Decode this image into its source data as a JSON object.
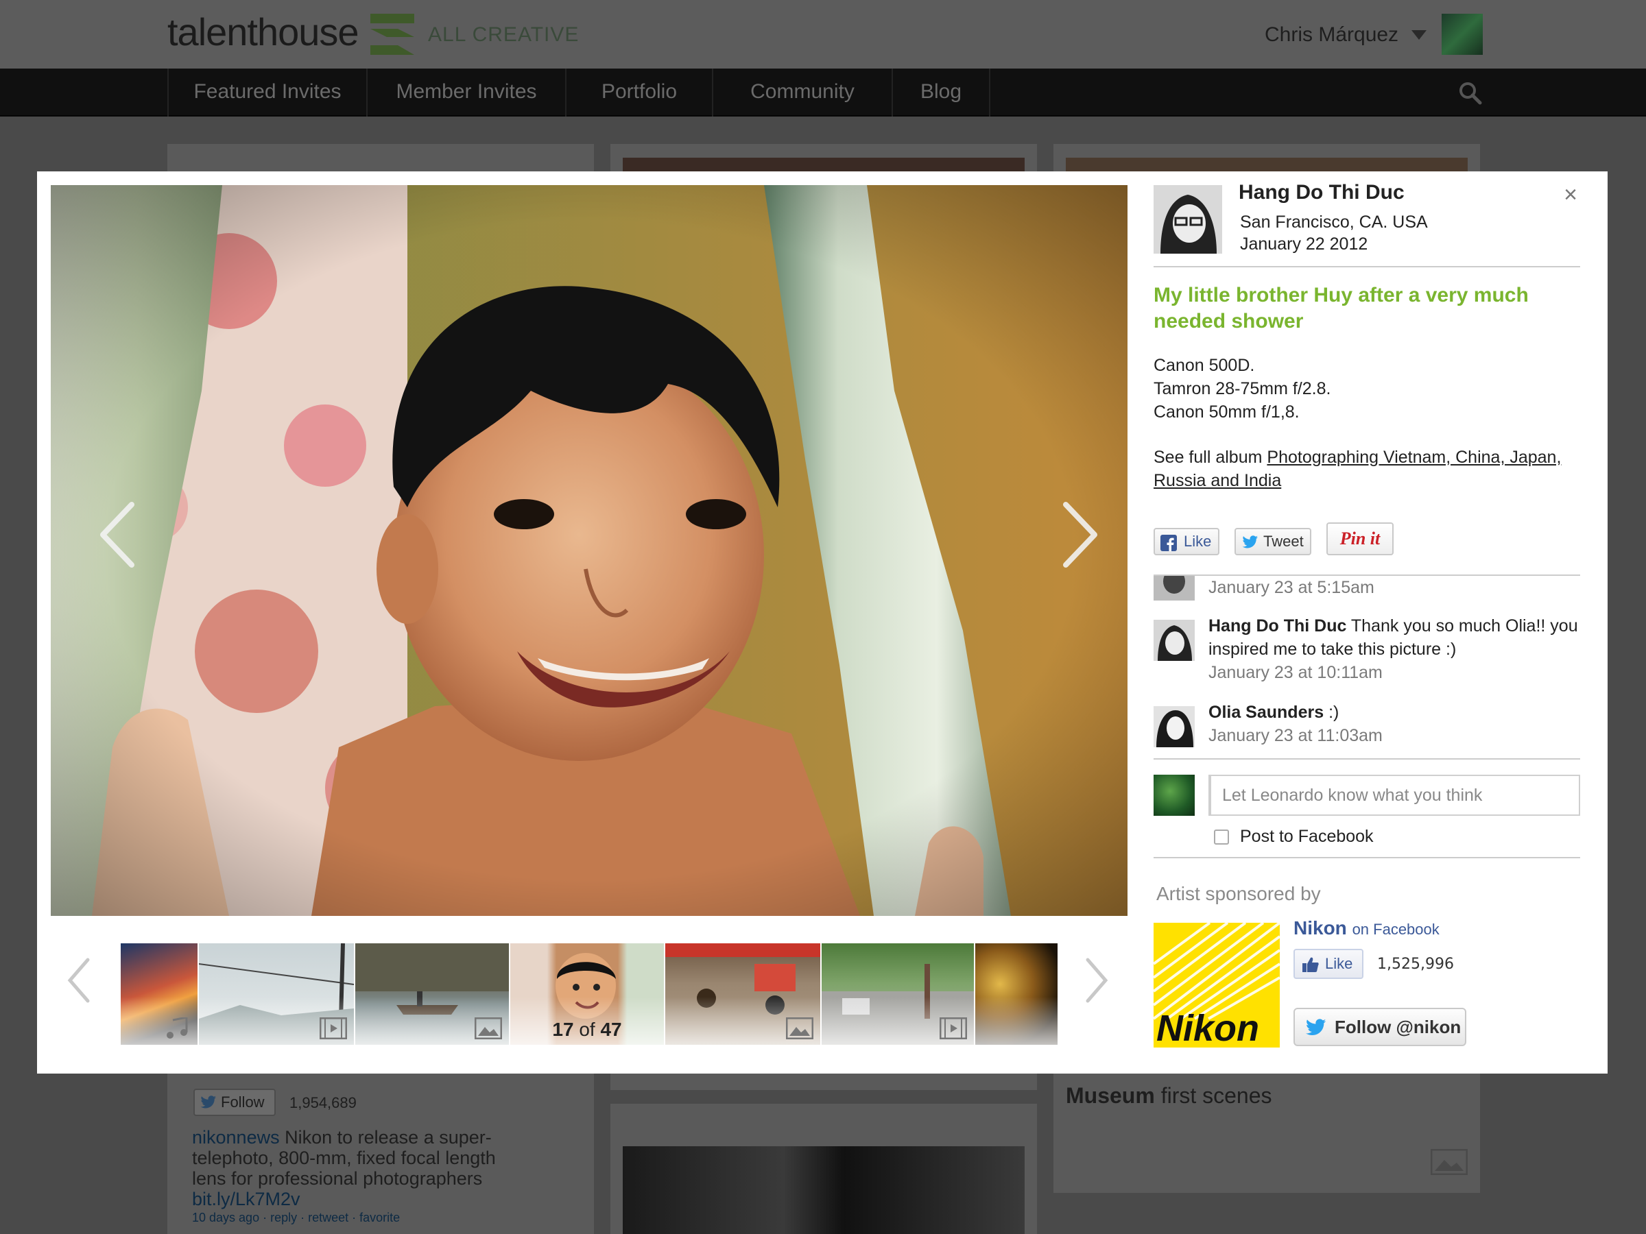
{
  "app": {
    "logo_text": "talenthouse",
    "tagline": "ALL CREATIVE",
    "user_name": "Chris Márquez"
  },
  "nav": {
    "items": [
      {
        "label": "Featured Invites"
      },
      {
        "label": "Member Invites"
      },
      {
        "label": "Portfolio"
      },
      {
        "label": "Community"
      },
      {
        "label": "Blog"
      }
    ]
  },
  "background": {
    "twitter_follow_label": "Follow",
    "twitter_follow_count": "1,954,689",
    "tweet_handle": "nikonnews",
    "tweet_text": "Nikon to release a super-telephoto, 800-mm, fixed focal length lens for professional photographers",
    "tweet_link": "bit.ly/Lk7M2v",
    "tweet_meta": "10 days ago · reply · retweet · favorite",
    "museum_title_bold": "Museum",
    "museum_title_rest": "first scenes"
  },
  "modal": {
    "close_label": "×",
    "counter_current": "17",
    "counter_of": "of",
    "counter_total": "47",
    "author": {
      "name": "Hang Do Thi Duc",
      "location": "San Francisco, CA. USA",
      "date": "January 22 2012"
    },
    "photo_title": "My little brother Huy after a very much needed shower",
    "gear": [
      "Canon 500D.",
      "Tamron 28-75mm f/2.8.",
      "Canon 50mm f/1,8."
    ],
    "album_prefix": "See full album",
    "album_link": "Photographing Vietnam, China, Japan, Russia and India",
    "share": {
      "like_label": "Like",
      "tweet_label": "Tweet",
      "pin_label": "Pin it"
    },
    "comments": [
      {
        "author": "",
        "text": "",
        "time": "January 23 at 5:15am"
      },
      {
        "author": "Hang Do Thi Duc",
        "text": "Thank you so much Olia!! you inspired me to take this picture :)",
        "time": "January 23 at 10:11am"
      },
      {
        "author": "Olia Saunders",
        "text": ":)",
        "time": "January 23 at 11:03am"
      }
    ],
    "reply_placeholder": "Let Leonardo know what you think",
    "post_to_facebook_label": "Post to Facebook",
    "sponsor": {
      "label": "Artist sponsored by",
      "brand": "Nikon",
      "brand_suffix": "on Facebook",
      "logo_text": "Nikon",
      "like_label": "Like",
      "like_count": "1,525,996",
      "follow_label": "Follow @nikon"
    },
    "thumbnails": [
      {
        "icon": "music-note-icon"
      },
      {
        "icon": "video-icon"
      },
      {
        "icon": "image-icon"
      },
      {
        "icon": ""
      },
      {
        "icon": "image-icon"
      },
      {
        "icon": "video-icon"
      },
      {
        "icon": ""
      }
    ]
  },
  "colors": {
    "accent_green": "#7ab52f",
    "facebook_blue": "#3b5998",
    "pinterest_red": "#cb2027",
    "nikon_yellow": "#ffe100"
  }
}
